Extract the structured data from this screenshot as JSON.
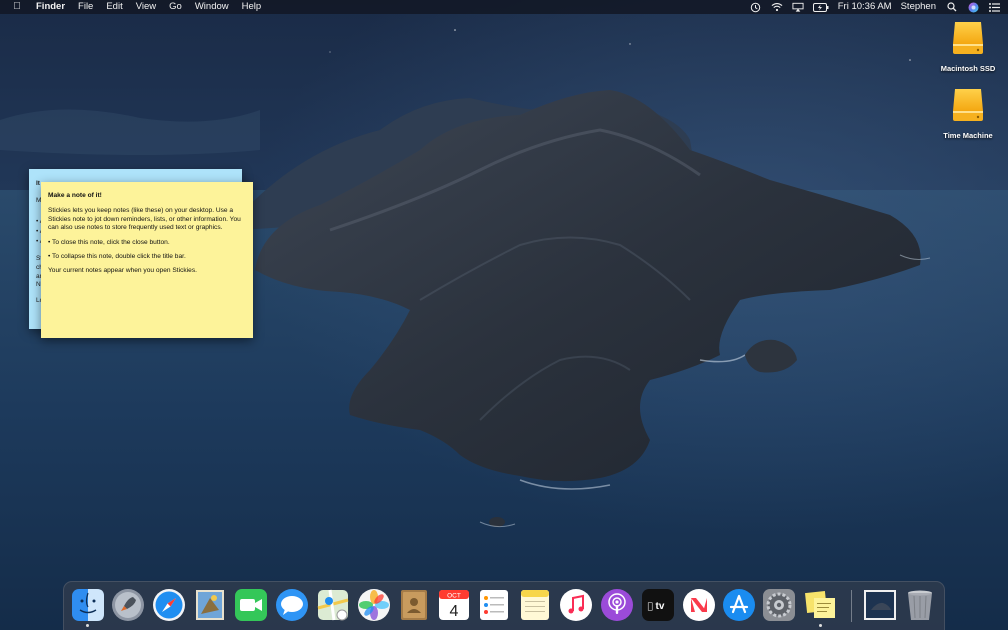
{
  "menubar": {
    "app_name": "Finder",
    "menus": [
      "File",
      "Edit",
      "View",
      "Go",
      "Window",
      "Help"
    ],
    "clock": "Fri 10:36 AM",
    "user": "Stephen",
    "status_icons": [
      "time-machine-icon",
      "wifi-icon",
      "airplay-icon",
      "battery-icon",
      "spotlight-icon",
      "siri-icon",
      "notification-center-icon"
    ]
  },
  "desktop": {
    "icons": [
      {
        "label": "Macintosh SSD"
      },
      {
        "label": "Time Machine"
      }
    ]
  },
  "stickies": {
    "blue_note": {
      "fragments": [
        "It",
        "M",
        "• A",
        "• A",
        "• A",
        "St",
        "ch",
        "an",
        "N",
        "Lo"
      ]
    },
    "yellow_note": {
      "title": "Make a note of it!",
      "paragraphs": [
        "Stickies lets you keep notes (like these) on your desktop. Use a Stickies note to jot down reminders, lists, or other information. You can also use notes to store frequently used text or graphics.",
        "• To close this note, click the close button.",
        "• To collapse this note, double click the title bar.",
        "Your current notes appear when you open Stickies."
      ]
    }
  },
  "dock": {
    "apps": [
      {
        "name": "Finder",
        "running": true
      },
      {
        "name": "Launchpad",
        "running": false
      },
      {
        "name": "Safari",
        "running": false
      },
      {
        "name": "Mail",
        "running": false
      },
      {
        "name": "FaceTime",
        "running": false
      },
      {
        "name": "Messages",
        "running": false
      },
      {
        "name": "Maps",
        "running": false
      },
      {
        "name": "Photos",
        "running": false
      },
      {
        "name": "Contacts",
        "running": false
      },
      {
        "name": "Calendar",
        "running": false
      },
      {
        "name": "Reminders",
        "running": false
      },
      {
        "name": "Notes",
        "running": false
      },
      {
        "name": "Music",
        "running": false
      },
      {
        "name": "Podcasts",
        "running": false
      },
      {
        "name": "TV",
        "running": false
      },
      {
        "name": "News",
        "running": false
      },
      {
        "name": "App Store",
        "running": false
      },
      {
        "name": "System Preferences",
        "running": false
      },
      {
        "name": "Stickies",
        "running": true
      }
    ],
    "calendar_month": "OCT",
    "calendar_day": "4",
    "tv_label": "tv",
    "others": [
      {
        "name": "Desktop Folder"
      },
      {
        "name": "Trash"
      }
    ]
  }
}
